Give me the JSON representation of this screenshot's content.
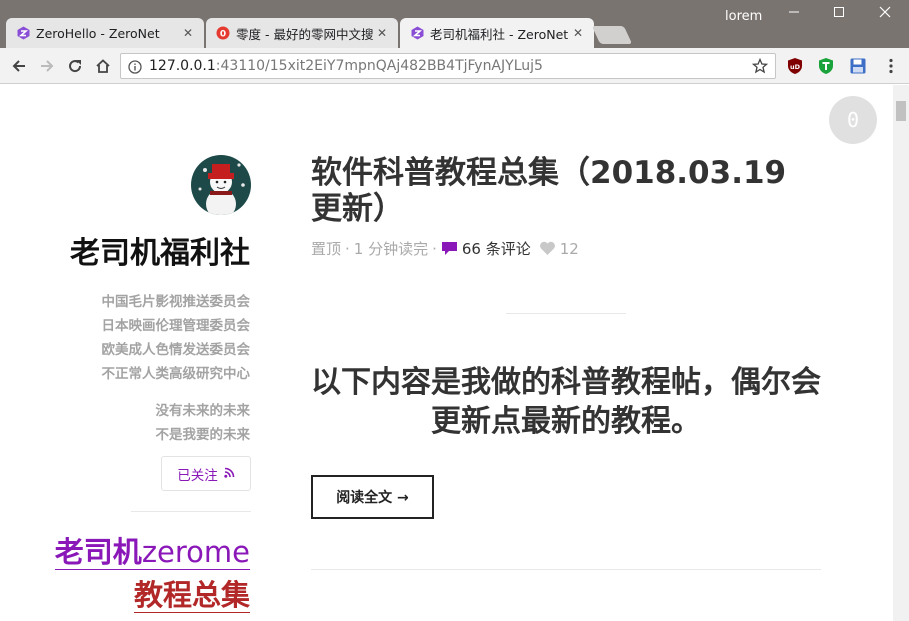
{
  "browser": {
    "tabs": [
      {
        "title": "ZeroHello - ZeroNet",
        "active": false
      },
      {
        "title": "零度 - 最好的零网中文搜",
        "active": false
      },
      {
        "title": "老司机福利社 - ZeroNet",
        "active": true
      }
    ],
    "tab_close": "✕",
    "user": "lorem",
    "address": {
      "host": "127.0.0.1",
      "rest": ":43110/15xit2EiY7mpnQAj482BB4TjFynAJYLuj5"
    }
  },
  "badge": "0",
  "sidebar": {
    "site_title": "老司机福利社",
    "taglines": [
      "中国毛片影视推送委员会",
      "日本映画伦理管理委员会",
      "欧美成人色情发送委员会",
      "不正常人类高级研究中心"
    ],
    "taglines2": [
      "没有未来的未来",
      "不是我要的未来"
    ],
    "follow_label": "已关注",
    "promo_line1_cn": "老司机",
    "promo_line1_en": "zerome",
    "promo_line2": "教程总集"
  },
  "post": {
    "title": "软件科普教程总集（2018.03.19更新）",
    "meta_pinned": "置顶",
    "meta_sep": "·",
    "meta_read": "1 分钟读完",
    "meta_comments": "66 条评论",
    "meta_likes": "12",
    "body": "以下内容是我做的科普教程帖，偶尔会更新点最新的教程。",
    "read_more": "阅读全文 →"
  },
  "colors": {
    "accent": "#8a18b8",
    "promo_red": "#b22727",
    "chrome_frame": "#7a7471"
  }
}
